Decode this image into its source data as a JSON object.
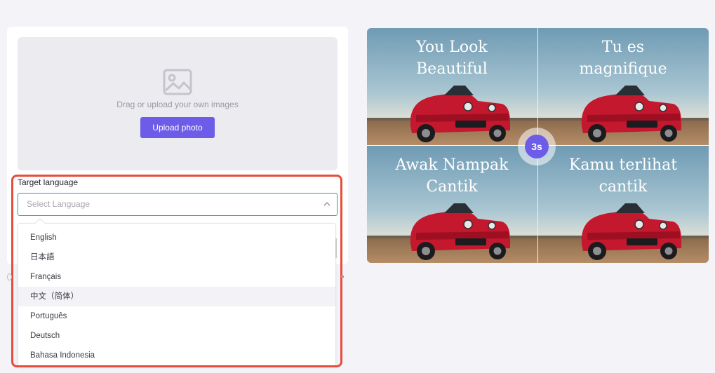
{
  "upload": {
    "hint": "Drag or upload your own images",
    "button_label": "Upload photo"
  },
  "language": {
    "label": "Target language",
    "placeholder": "Select Language",
    "options": [
      "English",
      "日本語",
      "Français",
      "中文（简体）",
      "Português",
      "Deutsch",
      "Bahasa Indonesia"
    ],
    "hovered_option": "中文（简体）"
  },
  "preview": {
    "captions": [
      [
        "You Look",
        "Beautiful"
      ],
      [
        "Tu es",
        "magnifique"
      ],
      [
        "Awak Nampak",
        "Cantik"
      ],
      [
        "Kamu terlihat",
        "cantik"
      ]
    ],
    "timer": "3s"
  },
  "colors": {
    "accent": "#6c5ce7",
    "highlight_border": "#e74c3c",
    "select_border": "#2e9aa0",
    "car": "#c4182e"
  },
  "icons": [
    "image-icon",
    "chevron-up-icon"
  ]
}
